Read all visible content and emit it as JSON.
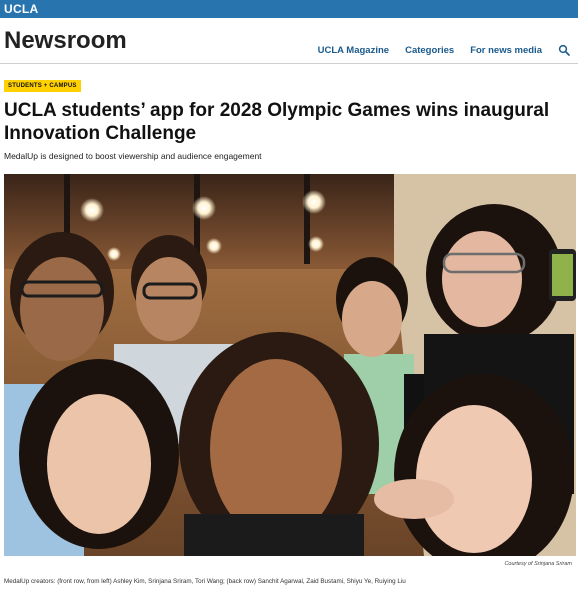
{
  "topbar": {
    "brand": "UCLA"
  },
  "header": {
    "site_title": "Newsroom",
    "nav": [
      "UCLA Magazine",
      "Categories",
      "For news media"
    ]
  },
  "article": {
    "tag": "STUDENTS + CAMPUS",
    "headline_line1": "UCLA students’ app for 2028 Olympic Games wins inaugural",
    "headline_line2": "Innovation Challenge",
    "dek": "MedalUp is designed to boost viewership and audience engagement",
    "photo_credit": "Courtesy of Srinjana Sriram",
    "caption": "MedalUp creators: (front row, from left) Ashley Kim, Srinjana Sriram, Tori Wang; (back row) Sanchit Agarwal, Zaid Bustami, Shiyu Ye, Ruiying Liu"
  },
  "colors": {
    "ucla_blue": "#2774ae",
    "tag_gold": "#ffd100",
    "nav_link": "#1a5a8c"
  },
  "icons": {
    "search": "search-icon"
  }
}
